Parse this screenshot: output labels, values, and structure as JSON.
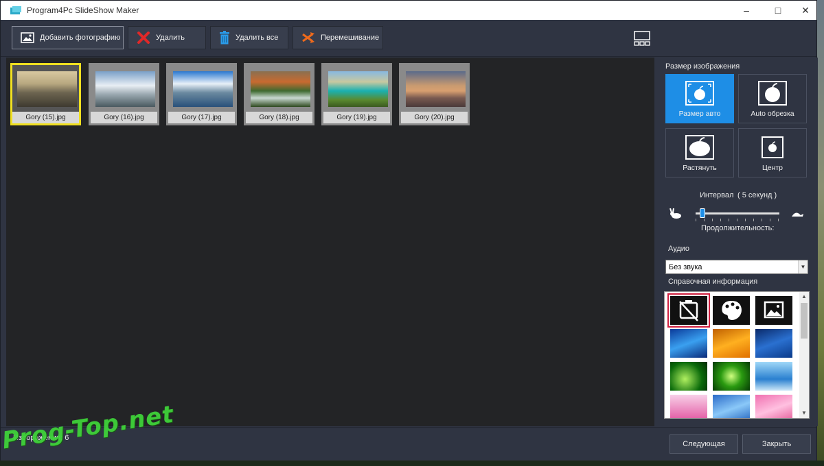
{
  "window": {
    "title": "Program4Pc SlideShow Maker"
  },
  "toolbar": {
    "add_photo": "Добавить фотографию",
    "delete": "Удалить",
    "delete_all": "Удалить все",
    "shuffle": "Перемешивание",
    "icons": {
      "add_photo": "image-icon",
      "delete": "red-x-icon",
      "delete_all": "trash-icon",
      "shuffle": "shuffle-icon",
      "view": "grid-view-icon"
    }
  },
  "gallery": {
    "items": [
      {
        "label": "Gory (15).jpg",
        "selected": true
      },
      {
        "label": "Gory (16).jpg",
        "selected": false
      },
      {
        "label": "Gory (17).jpg",
        "selected": false
      },
      {
        "label": "Gory (18).jpg",
        "selected": false
      },
      {
        "label": "Gory (19).jpg",
        "selected": false
      },
      {
        "label": "Gory (20).jpg",
        "selected": false
      }
    ]
  },
  "panel": {
    "image_size_label": "Размер изображения",
    "size_options": [
      {
        "label": "Размер авто",
        "active": true
      },
      {
        "label": "Auto обрезка",
        "active": false
      },
      {
        "label": "Растянуть",
        "active": false
      },
      {
        "label": "Центр",
        "active": false
      }
    ],
    "interval_label": "Интервал",
    "interval_value": "( 5 секунд )",
    "duration_label": "Продолжительность:",
    "slider_value_seconds": 5,
    "audio_label": "Аудио",
    "audio_value": "Без звука",
    "help_label": "Справочная информация",
    "accent_color": "#1e8ee6"
  },
  "footer": {
    "images_count": "Изображения: 6",
    "next": "Следующая",
    "close": "Закрыть"
  },
  "watermark": "Prog-Top.net"
}
